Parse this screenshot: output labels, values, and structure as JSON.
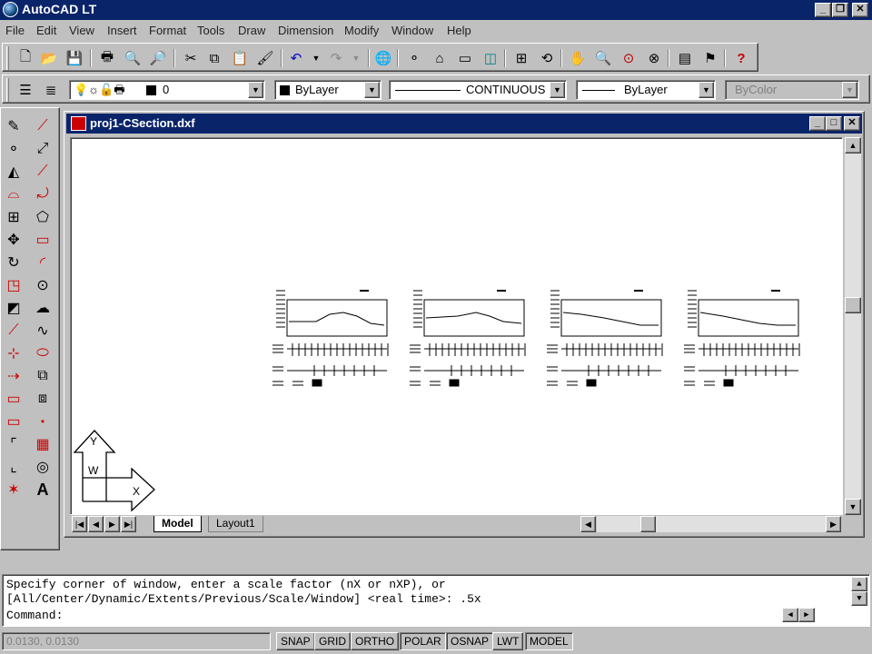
{
  "window": {
    "title": "AutoCAD LT"
  },
  "menu": [
    "File",
    "Edit",
    "View",
    "Insert",
    "Format",
    "Tools",
    "Draw",
    "Dimension",
    "Modify",
    "Window",
    "Help"
  ],
  "props": {
    "layer": "0",
    "color": "ByLayer",
    "linetype": "CONTINUOUS",
    "lineweight": "ByLayer",
    "plotstyle": "ByColor"
  },
  "document": {
    "title": "proj1-CSection.dxf",
    "tabs": [
      "Model",
      "Layout1"
    ],
    "ucs_labels": {
      "y": "Y",
      "w": "W",
      "x": "X"
    }
  },
  "command": {
    "lines": [
      "Specify corner of window, enter a scale factor (nX or nXP), or",
      "[All/Center/Dynamic/Extents/Previous/Scale/Window] <real time>: .5x",
      "Command:"
    ]
  },
  "status": {
    "coords": "0.0130, 0.0130",
    "toggles": [
      "SNAP",
      "GRID",
      "ORTHO",
      "POLAR",
      "OSNAP",
      "LWT",
      "MODEL"
    ]
  },
  "colors": {
    "titlebar": "#0a246a",
    "face": "#c0c0c0",
    "canvas": "#ffffff"
  }
}
